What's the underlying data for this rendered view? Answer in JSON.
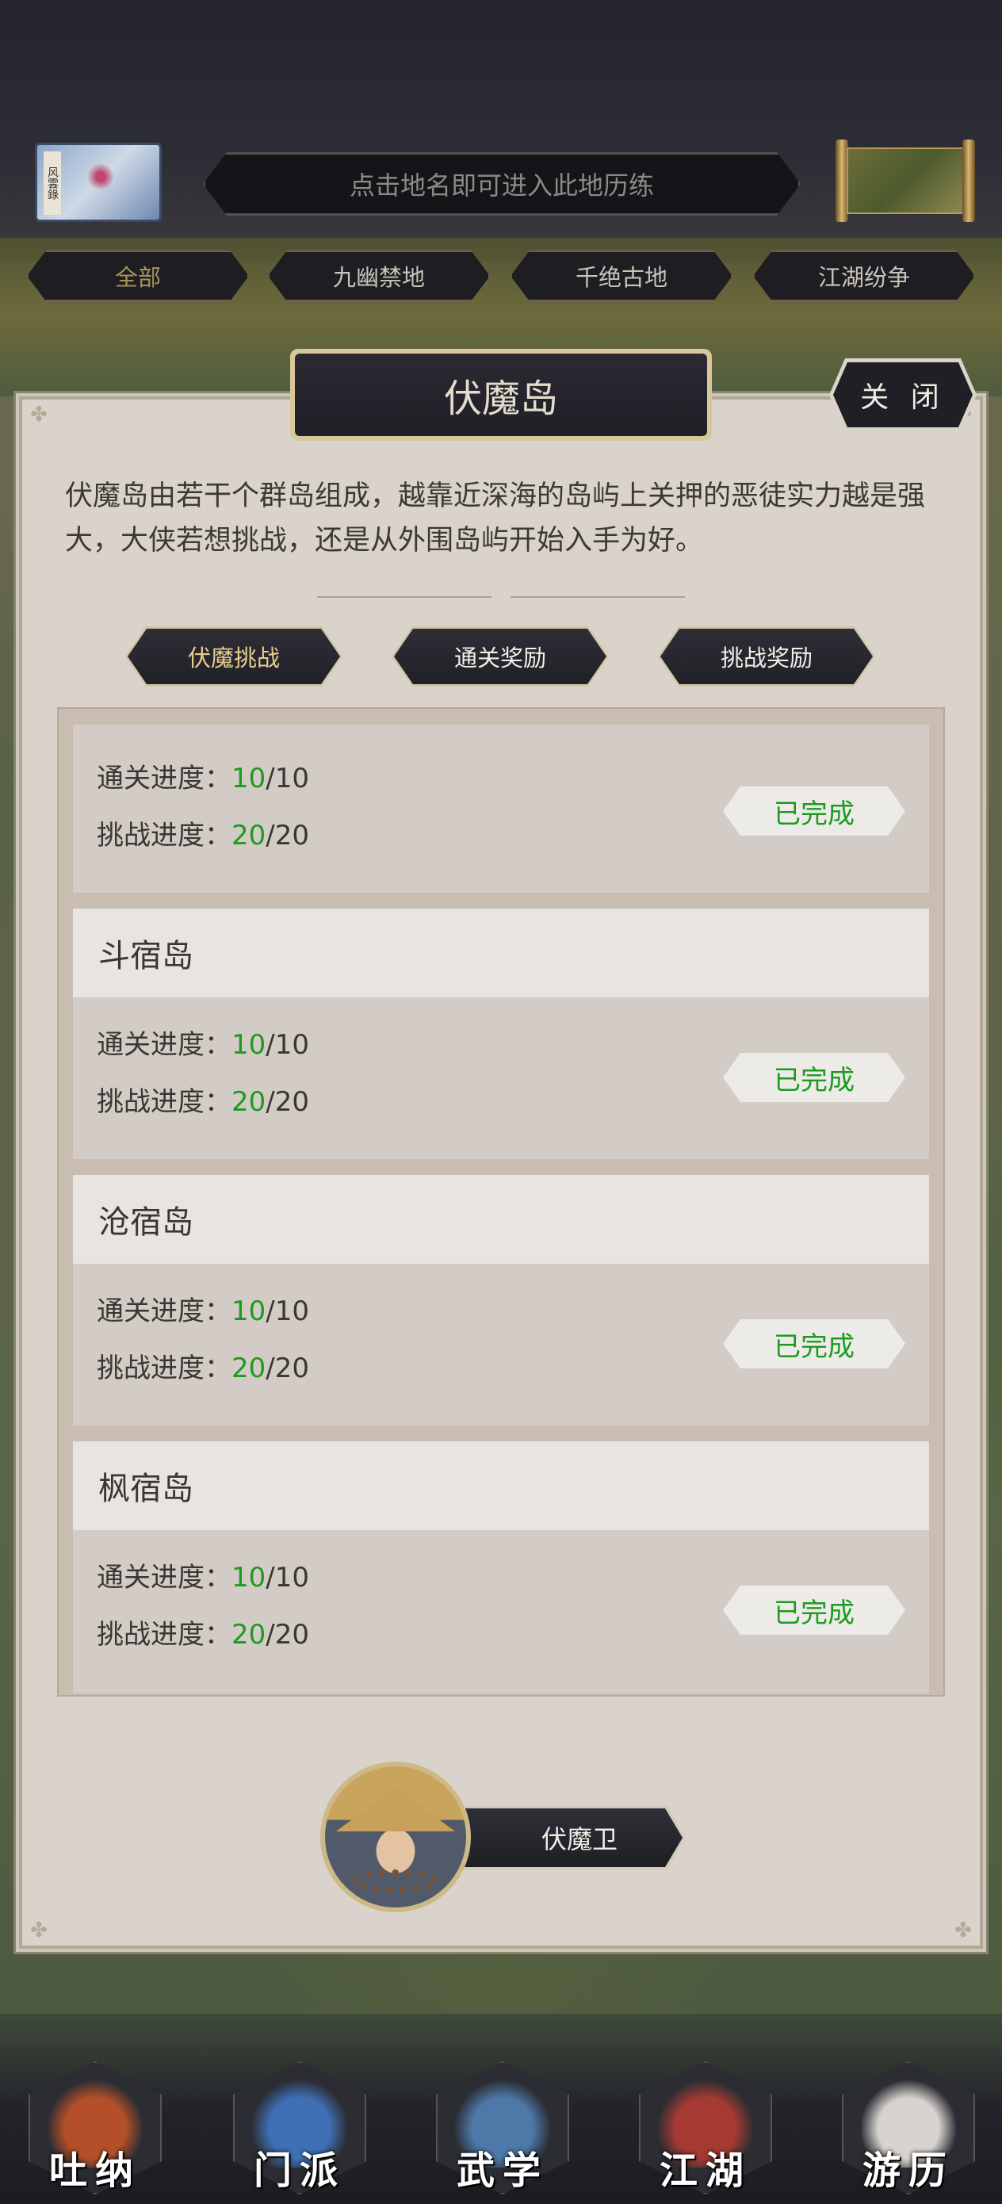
{
  "top_bar": {
    "map_stamp": "风雲錄",
    "hint": "点击地名即可进入此地历练"
  },
  "categories": [
    {
      "label": "全部",
      "active": true
    },
    {
      "label": "九幽禁地",
      "active": false
    },
    {
      "label": "千绝古地",
      "active": false
    },
    {
      "label": "江湖纷争",
      "active": false
    }
  ],
  "panel": {
    "title": "伏魔岛",
    "close_label": "关 闭",
    "description": "伏魔岛由若干个群岛组成，越靠近深海的岛屿上关押的恶徒实力越是强大，大侠若想挑战，还是从外围岛屿开始入手为好。",
    "sub_tabs": [
      {
        "label": "伏魔挑战",
        "active": true
      },
      {
        "label": "通关奖励",
        "active": false
      },
      {
        "label": "挑战奖励",
        "active": false
      }
    ]
  },
  "islands": [
    {
      "name": "",
      "clear_label": "通关进度：",
      "clear_cur": "10",
      "clear_total": "/10",
      "challenge_label": "挑战进度：",
      "challenge_cur": "20",
      "challenge_total": "/20",
      "status": "已完成"
    },
    {
      "name": "斗宿岛",
      "clear_label": "通关进度：",
      "clear_cur": "10",
      "clear_total": "/10",
      "challenge_label": "挑战进度：",
      "challenge_cur": "20",
      "challenge_total": "/20",
      "status": "已完成"
    },
    {
      "name": "沧宿岛",
      "clear_label": "通关进度：",
      "clear_cur": "10",
      "clear_total": "/10",
      "challenge_label": "挑战进度：",
      "challenge_cur": "20",
      "challenge_total": "/20",
      "status": "已完成"
    },
    {
      "name": "枫宿岛",
      "clear_label": "通关进度：",
      "clear_cur": "10",
      "clear_total": "/10",
      "challenge_label": "挑战进度：",
      "challenge_cur": "20",
      "challenge_total": "/20",
      "status": "已完成"
    }
  ],
  "guard": {
    "label": "伏魔卫"
  },
  "bottom_nav": [
    {
      "label": "吐纳",
      "icon": "monk-icon",
      "color": "#b3502a"
    },
    {
      "label": "门派",
      "icon": "banner-icon",
      "color": "#3f6fb5"
    },
    {
      "label": "武学",
      "icon": "book-icon",
      "color": "#4d78a8"
    },
    {
      "label": "江湖",
      "icon": "hat-icon",
      "color": "#a53a33"
    },
    {
      "label": "游历",
      "icon": "horse-icon",
      "color": "#d9d3cf"
    }
  ],
  "colors": {
    "progress_current": "#1e9a20",
    "panel_bg": "#d9d3cc",
    "dark_button": "#1f1f25",
    "gold_trim": "#d8c79a"
  }
}
